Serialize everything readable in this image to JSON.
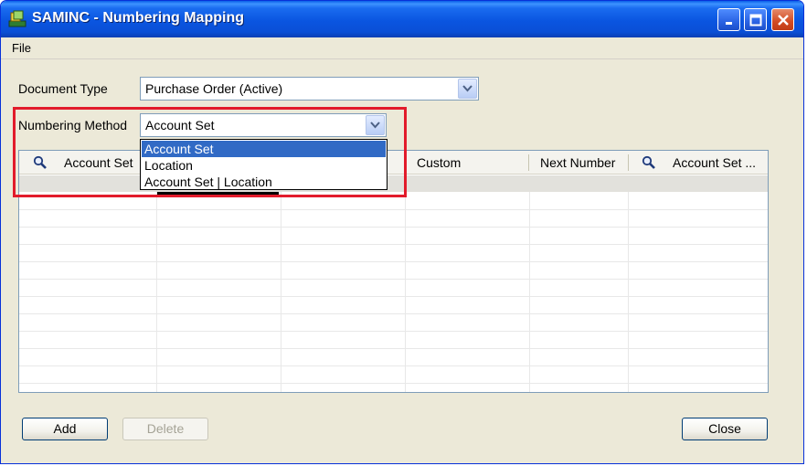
{
  "window": {
    "title": "SAMINC - Numbering Mapping",
    "icons": {
      "app": "saminc-app-icon",
      "minimize": "minimize-icon",
      "maximize": "maximize-icon",
      "close": "close-icon"
    }
  },
  "menu": {
    "file": "File"
  },
  "form": {
    "document_type_label": "Document Type",
    "document_type_value": "Purchase Order (Active)",
    "numbering_method_label": "Numbering Method",
    "numbering_method_value": "Account Set"
  },
  "dropdown": {
    "options": [
      "Account Set",
      "Location",
      "Account Set | Location"
    ],
    "selected_index": 0
  },
  "grid": {
    "columns": [
      {
        "label": "Account Set",
        "icon": "search-icon"
      },
      {
        "label": ""
      },
      {
        "label": ""
      },
      {
        "label": "Custom"
      },
      {
        "label": "Next Number"
      },
      {
        "label": "Account Set ...",
        "icon": "search-icon"
      }
    ],
    "rows": []
  },
  "buttons": {
    "add": "Add",
    "delete": "Delete",
    "close": "Close"
  },
  "colors": {
    "title_bar": "#0a55e0",
    "highlight": "#e21b2b",
    "selection": "#316ac5",
    "window_bg": "#ece9d8"
  }
}
